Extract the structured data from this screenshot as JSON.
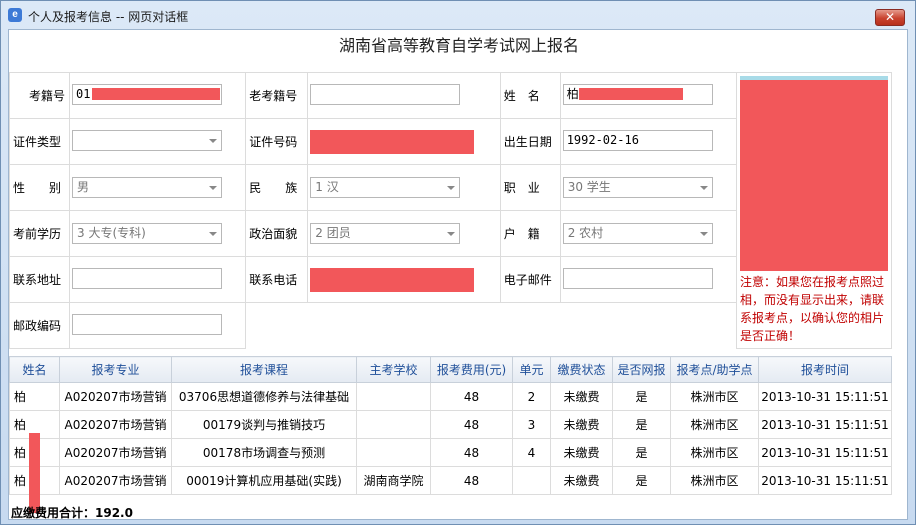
{
  "window": {
    "title": "个人及报考信息 -- 网页对话框",
    "icon": "ie-icon",
    "close_label": "✕"
  },
  "heading": "湖南省高等教育自学考试网上报名",
  "form": {
    "exam_no_label": "考籍号",
    "exam_no_value": "01",
    "old_exam_no_label": "老考籍号",
    "old_exam_no_value": "",
    "name_label": "姓　名",
    "name_value": "柏",
    "id_type_label": "证件类型",
    "id_type_value": "",
    "id_no_label": "证件号码",
    "birth_label": "出生日期",
    "birth_value": "1992-02-16",
    "gender_label": "性　　别",
    "gender_value": "男",
    "ethnic_label": "民　　族",
    "ethnic_value": "1 汉",
    "job_label": "职　业",
    "job_value": "30 学生",
    "edu_label": "考前学历",
    "edu_value": "3 大专(专科)",
    "political_label": "政治面貌",
    "political_value": "2 团员",
    "huji_label": "户　籍",
    "huji_value": "2 农村",
    "address_label": "联系地址",
    "address_value": "",
    "phone_label": "联系电话",
    "email_label": "电子邮件",
    "email_value": "",
    "postcode_label": "邮政编码",
    "postcode_value": ""
  },
  "notice": "注意：如果您在报考点照过相，而没有显示出来，请联系报考点，以确认您的相片是否正确！",
  "table": {
    "headers": [
      "姓名",
      "报考专业",
      "报考课程",
      "主考学校",
      "报考费用(元)",
      "单元",
      "缴费状态",
      "是否网报",
      "报考点/助学点",
      "报考时间"
    ],
    "rows": [
      [
        "柏",
        "A020207市场营销",
        "03706思想道德修养与法律基础",
        "",
        "48",
        "2",
        "未缴费",
        "是",
        "株洲市区",
        "2013-10-31 15:11:51"
      ],
      [
        "柏",
        "A020207市场营销",
        "00179谈判与推销技巧",
        "",
        "48",
        "3",
        "未缴费",
        "是",
        "株洲市区",
        "2013-10-31 15:11:51"
      ],
      [
        "柏",
        "A020207市场营销",
        "00178市场调查与预测",
        "",
        "48",
        "4",
        "未缴费",
        "是",
        "株洲市区",
        "2013-10-31 15:11:51"
      ],
      [
        "柏",
        "A020207市场营销",
        "00019计算机应用基础(实践)",
        "湖南商学院",
        "48",
        "",
        "未缴费",
        "是",
        "株洲市区",
        "2013-10-31 15:11:51"
      ]
    ]
  },
  "total": "应缴费用合计：192.0",
  "colors": {
    "redaction": "#f2575a",
    "notice": "#c00000",
    "header_text": "#1f4f99"
  }
}
